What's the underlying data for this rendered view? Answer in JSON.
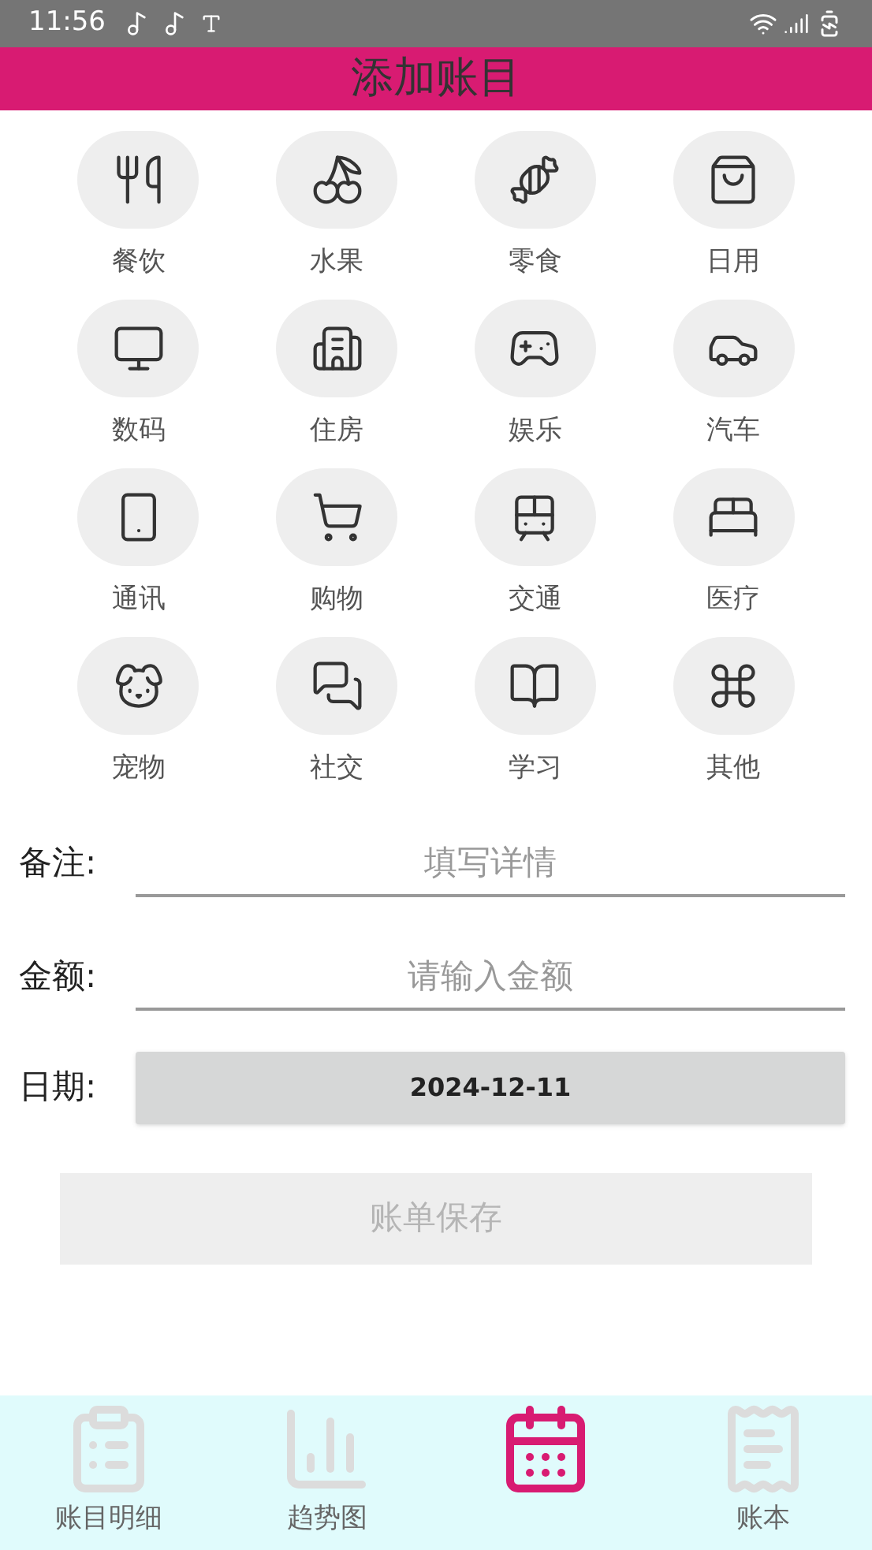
{
  "status_bar": {
    "time": "11:56"
  },
  "header": {
    "title": "添加账目"
  },
  "categories": [
    {
      "label": "餐饮"
    },
    {
      "label": "水果"
    },
    {
      "label": "零食"
    },
    {
      "label": "日用"
    },
    {
      "label": "数码"
    },
    {
      "label": "住房"
    },
    {
      "label": "娱乐"
    },
    {
      "label": "汽车"
    },
    {
      "label": "通讯"
    },
    {
      "label": "购物"
    },
    {
      "label": "交通"
    },
    {
      "label": "医疗"
    },
    {
      "label": "宠物"
    },
    {
      "label": "社交"
    },
    {
      "label": "学习"
    },
    {
      "label": "其他"
    }
  ],
  "form": {
    "note": {
      "label": "备注:",
      "placeholder": "填写详情"
    },
    "amount": {
      "label": "金额:",
      "placeholder": "请输入金额"
    },
    "date": {
      "label": "日期:",
      "value": "2024-12-11"
    },
    "save_button": "账单保存"
  },
  "bottom_nav": [
    {
      "label": "账目明细",
      "selected": false
    },
    {
      "label": "趋势图",
      "selected": false
    },
    {
      "selected": true
    },
    {
      "label": "账本",
      "selected": false
    }
  ]
}
